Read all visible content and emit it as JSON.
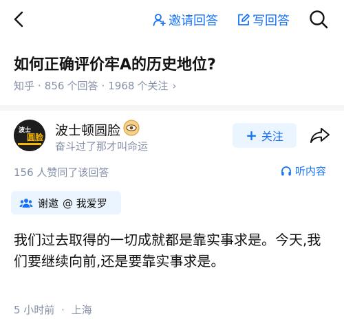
{
  "header": {
    "invite_label": "邀请回答",
    "write_label": "写回答",
    "accent_color": "#1772f6"
  },
  "question": {
    "title": "如何正确评价牢A的历史地位?",
    "site": "知乎",
    "answers_count": "856",
    "answers_unit": "个回答",
    "followers_count": "1968",
    "followers_unit": "个关注"
  },
  "author": {
    "name": "波士顿圆脸",
    "bio": "奋斗过了那才叫命运",
    "avatar_line1": "波士",
    "avatar_line2": "圆脸",
    "follow_label": "关注",
    "badge_icon": "eye-badge-icon"
  },
  "answer": {
    "upvote_text": "156 人赞同了该回答",
    "listen_label": "听内容",
    "invite_prefix": "谢邀",
    "invite_user": "@ 我爱罗",
    "content": "我们过去取得的一切成就都是靠实事求是。今天,我们要继续向前,还是要靠实事求是。",
    "time": "5 小时前",
    "location": "上海"
  },
  "icons": [
    "back-arrow-icon",
    "user-plus-icon",
    "edit-icon",
    "search-icon",
    "share-icon",
    "headphones-icon",
    "people-icon"
  ]
}
